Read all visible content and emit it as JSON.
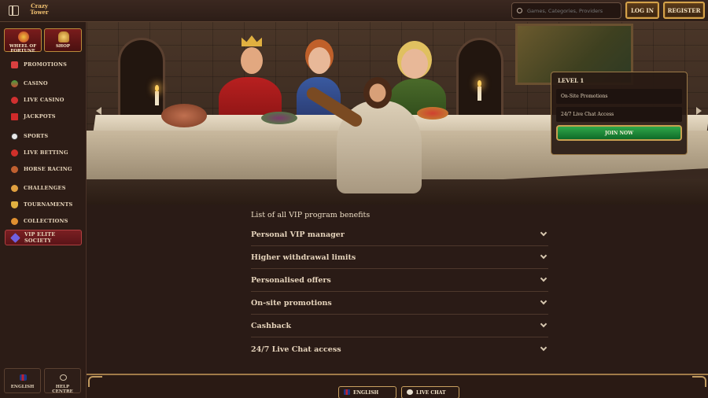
{
  "header": {
    "logo_text": "Crazy Tower",
    "search_placeholder": "Games, Categories, Providers",
    "login_label": "LOG IN",
    "register_label": "REGISTER"
  },
  "sidebar": {
    "tiles": [
      {
        "label": "WHEEL OF FORTUNE",
        "icon": "wheel-icon"
      },
      {
        "label": "SHOP",
        "icon": "shop-icon"
      }
    ],
    "items": [
      {
        "label": "PROMOTIONS",
        "icon": "gift-icon",
        "color": "#d94040"
      },
      {
        "label": "CASINO",
        "icon": "casino-icon",
        "color": "#c84a32"
      },
      {
        "label": "LIVE CASINO",
        "icon": "live-casino-icon",
        "color": "#d03030"
      },
      {
        "label": "JACKPOTS",
        "icon": "seven-icon",
        "color": "#d02a2a"
      },
      {
        "label": "SPORTS",
        "icon": "ball-icon",
        "color": "#e8e8e8"
      },
      {
        "label": "LIVE BETTING",
        "icon": "live-betting-icon",
        "color": "#d0302a"
      },
      {
        "label": "HORSE RACING",
        "icon": "horse-icon",
        "color": "#c06030"
      },
      {
        "label": "CHALLENGES",
        "icon": "challenges-icon",
        "color": "#e0a040"
      },
      {
        "label": "TOURNAMENTS",
        "icon": "trophy-icon",
        "color": "#e0b040"
      },
      {
        "label": "COLLECTIONS",
        "icon": "collections-icon",
        "color": "#e09030"
      },
      {
        "label": "VIP ELITE SOCIETY",
        "icon": "gem-icon",
        "color": "#7060e0"
      }
    ],
    "footer": [
      {
        "label": "ENGLISH",
        "icon": "uk-flag-icon"
      },
      {
        "label": "HELP CENTRE",
        "icon": "help-icon"
      }
    ]
  },
  "banner": {
    "level_card": {
      "title": "LEVEL 1",
      "rows": [
        "On-Site Promotions",
        "24/7 Live Chat Access"
      ],
      "cta": "JOIN NOW"
    }
  },
  "vip": {
    "title": "List of all VIP program benefits",
    "benefits": [
      "Personal VIP manager",
      "Higher withdrawal limits",
      "Personalised offers",
      "On-site promotions",
      "Cashback",
      "24/7 Live Chat access"
    ]
  },
  "footer": {
    "language_label": "ENGLISH",
    "chat_label": "LIVE CHAT"
  },
  "colors": {
    "accent_gold": "#d4a24a",
    "active_red": "#7a1f22",
    "cta_green": "#1f8a3a"
  }
}
